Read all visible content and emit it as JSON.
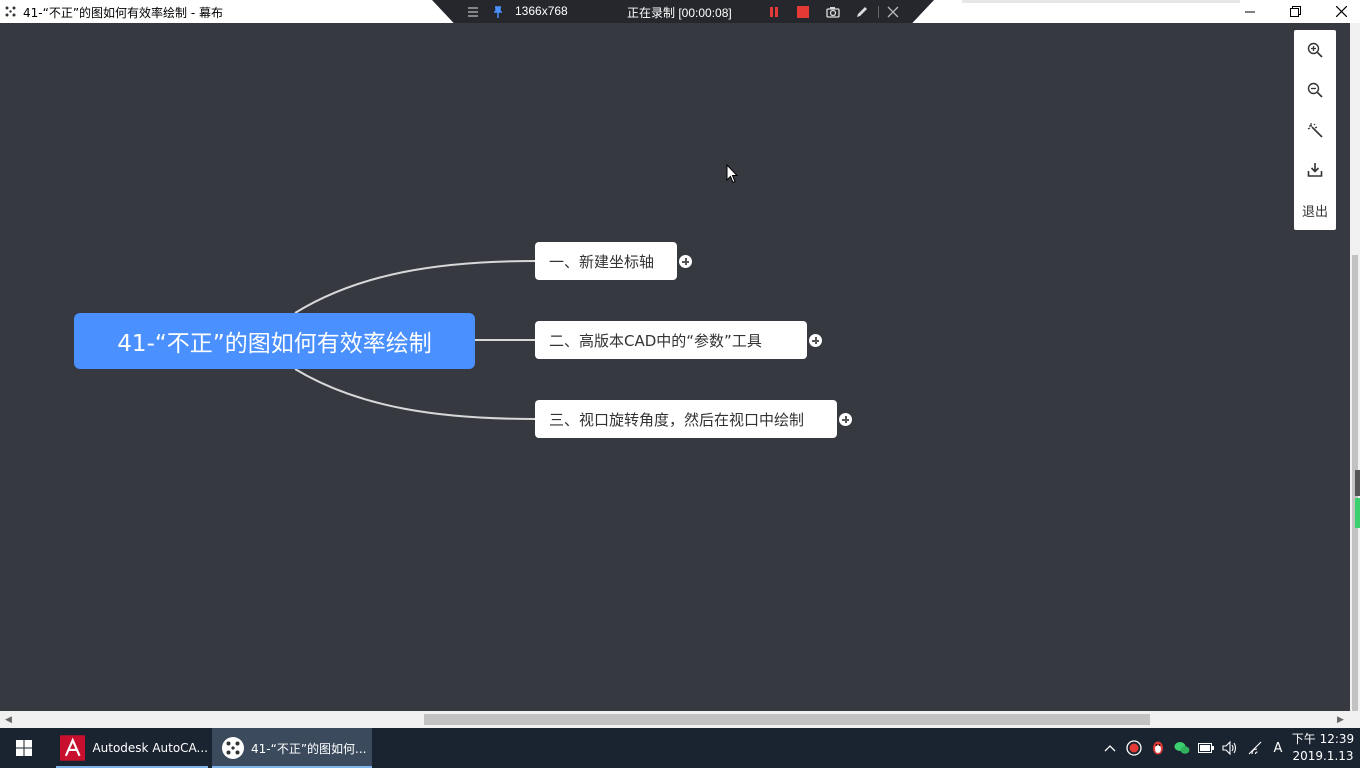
{
  "window": {
    "title": "41-“不正”的图如何有效率绘制 - 幕布",
    "minimize_icon": "minimize-icon",
    "restore_icon": "restore-icon",
    "close_icon": "close-icon"
  },
  "recorder": {
    "resolution": "1366x768",
    "status": "正在录制 [00:00:08]",
    "icons": [
      "menu-icon",
      "pin-icon",
      "pause-icon",
      "stop-icon",
      "camera-icon",
      "pen-icon",
      "close-icon"
    ],
    "pause_color": "#e53935",
    "stop_color": "#e53935"
  },
  "mindmap": {
    "root": "41-“不正”的图如何有效率绘制",
    "children": [
      "一、新建坐标轴",
      "二、高版本CAD中的“参数”工具",
      "三、视口旋转角度，然后在视口中绘制"
    ],
    "root_color": "#4a90ff",
    "background_color": "#363940"
  },
  "toolbar": {
    "items": [
      "zoom-in-icon",
      "zoom-out-icon",
      "magic-wand-icon",
      "download-icon"
    ],
    "exit_label": "退出"
  },
  "taskbar": {
    "apps": [
      {
        "label": "Autodesk AutoCA...",
        "icon": "autocad-icon"
      },
      {
        "label": "41-“不正”的图如何...",
        "icon": "mubu-icon"
      }
    ],
    "clock_time": "下午 12:39",
    "clock_date": "2019.1.13",
    "ime_label": "A"
  }
}
